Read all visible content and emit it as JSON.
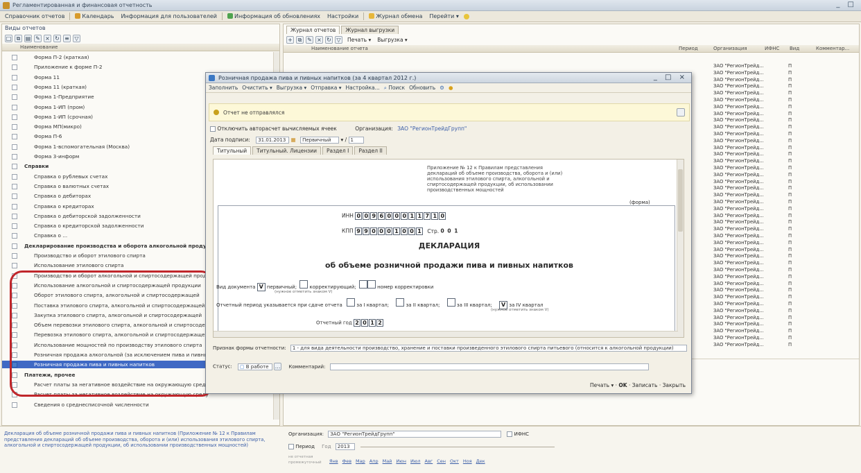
{
  "window": {
    "title": "Регламентированная и финансовая отчетность",
    "controls": "_ □"
  },
  "menubar": [
    "Справочник отчетов",
    "Календарь",
    "Информация для пользователей",
    "Информация об обновлениях",
    "Настройки",
    "Журнал обмена",
    "Перейти ▾"
  ],
  "left_panel": {
    "header": "Виды отчетов",
    "column": "Наименование",
    "rows": [
      {
        "label": "Форма П-2 (краткая)",
        "indent": 1,
        "checked": false,
        "group": false
      },
      {
        "label": "Приложение к форме П-2",
        "indent": 1,
        "checked": false,
        "group": false
      },
      {
        "label": "Форма 11",
        "indent": 1,
        "checked": false,
        "group": false
      },
      {
        "label": "Форма 11 (краткая)",
        "indent": 1,
        "checked": false,
        "group": false
      },
      {
        "label": "Форма 1-Предприятие",
        "indent": 1,
        "checked": false,
        "group": false
      },
      {
        "label": "Форма 1-ИП (пром)",
        "indent": 1,
        "checked": false,
        "group": false
      },
      {
        "label": "Форма 1-ИП (срочная)",
        "indent": 1,
        "checked": false,
        "group": false
      },
      {
        "label": "Форма МП(микро)",
        "indent": 1,
        "checked": false,
        "group": false
      },
      {
        "label": "Форма П-6",
        "indent": 1,
        "checked": false,
        "group": false
      },
      {
        "label": "Форма 1-вспомогательная (Москва)",
        "indent": 1,
        "checked": false,
        "group": false
      },
      {
        "label": "Форма 3-информ",
        "indent": 1,
        "checked": false,
        "group": false
      },
      {
        "label": "Справки",
        "indent": 0,
        "checked": false,
        "group": true
      },
      {
        "label": "Справка о рублевых счетах",
        "indent": 1,
        "checked": false,
        "group": false
      },
      {
        "label": "Справка о валютных счетах",
        "indent": 1,
        "checked": false,
        "group": false
      },
      {
        "label": "Справка о дебиторах",
        "indent": 1,
        "checked": false,
        "group": false
      },
      {
        "label": "Справка о кредиторах",
        "indent": 1,
        "checked": false,
        "group": false
      },
      {
        "label": "Справка о дебиторской задолженности",
        "indent": 1,
        "checked": false,
        "group": false
      },
      {
        "label": "Справка о кредиторской задолженности",
        "indent": 1,
        "checked": false,
        "group": false
      },
      {
        "label": "Справка о ...",
        "indent": 1,
        "checked": false,
        "group": false
      },
      {
        "label": "Декларирование производства и оборота алкогольной продукции",
        "indent": 0,
        "checked": false,
        "group": true
      },
      {
        "label": "Производство и оборот этилового спирта",
        "indent": 1,
        "checked": false,
        "group": false
      },
      {
        "label": "Использование этилового спирта",
        "indent": 1,
        "checked": false,
        "group": false
      },
      {
        "label": "Производство и оборот алкогольной и спиртосодержащей продукции",
        "indent": 1,
        "checked": false,
        "group": false
      },
      {
        "label": "Использование алкогольной и спиртосодержащей продукции",
        "indent": 1,
        "checked": false,
        "group": false
      },
      {
        "label": "Оборот этилового спирта, алкогольной и спиртосодержащей",
        "indent": 1,
        "checked": false,
        "group": false
      },
      {
        "label": "Поставка этилового спирта, алкогольной и спиртосодержащей",
        "indent": 1,
        "checked": false,
        "group": false
      },
      {
        "label": "Закупка этилового спирта, алкогольной и спиртосодержащей",
        "indent": 1,
        "checked": false,
        "group": false
      },
      {
        "label": "Объем перевозки этилового спирта, алкогольной и спиртосодержащей",
        "indent": 1,
        "checked": false,
        "group": false
      },
      {
        "label": "Перевозка этилового спирта, алкогольной и спиртосодержащей",
        "indent": 1,
        "checked": false,
        "group": false
      },
      {
        "label": "Использование мощностей по производству этилового спирта",
        "indent": 1,
        "checked": false,
        "group": false
      },
      {
        "label": "Розничная продажа алкогольной (за исключением пива и пивных напитков)",
        "indent": 1,
        "checked": false,
        "group": false
      },
      {
        "label": "Розничная продажа пива и пивных напитков",
        "indent": 1,
        "checked": true,
        "group": false,
        "selected": true
      },
      {
        "label": "Платежи, прочее",
        "indent": 0,
        "checked": false,
        "group": true
      },
      {
        "label": "Расчет платы за негативное воздействие на окружающую среду (основная форма)",
        "indent": 1,
        "checked": false,
        "group": false
      },
      {
        "label": "Расчет платы за негативное воздействие на окружающую среду",
        "indent": 1,
        "checked": false,
        "group": false
      },
      {
        "label": "Сведения о среднесписочной численности",
        "indent": 1,
        "checked": false,
        "group": false
      }
    ],
    "description": "Декларация об объеме розничной продажи пива и пивных напитков (Приложение № 12 к Правилам представления деклараций об объеме производства, оборота и (или) использования этилового спирта, алкогольной и спиртосодержащей продукции, об использовании производственных мощностей)"
  },
  "journal": {
    "tabs": [
      "Журнал отчетов",
      "Журнал выгрузки"
    ],
    "toolbar": [
      "Печать ▾",
      "Выгрузка ▾"
    ],
    "columns": [
      "Наименование отчета",
      "Период",
      "Организация",
      "ИФНС",
      "Вид",
      "Комментар..."
    ],
    "org_rows": [
      "ЗАО \"РегионТрейд...",
      "ЗАО \"РегионТрейд...",
      "ЗАО \"РегионТрейд...",
      "ЗАО \"РегионТрейд...",
      "ЗАО \"РегионТрейд...",
      "ЗАО \"РегионТрейд...",
      "ЗАО \"РегионТрейд...",
      "ЗАО \"РегионТрейд...",
      "ЗАО \"РегионТрейд...",
      "ЗАО \"РегионТрейд...",
      "ЗАО \"РегионТрейд...",
      "ЗАО \"РегионТрейд...",
      "ЗАО \"РегионТрейд...",
      "ЗАО \"РегионТрейд...",
      "ЗАО \"РегионТрейд...",
      "ЗАО \"РегионТрейд...",
      "ЗАО \"РегионТрейд...",
      "ЗАО \"РегионТрейд...",
      "ЗАО \"РегионТрейд...",
      "ЗАО \"РегионТрейд...",
      "ЗАО \"РегионТрейд...",
      "ЗАО \"РегионТрейд...",
      "ЗАО \"РегионТрейд...",
      "ЗАО \"РегионТрейд...",
      "ЗАО \"РегионТрейд...",
      "ЗАО \"РегионТрейд...",
      "ЗАО \"РегионТрейд...",
      "ЗАО \"РегионТрейд...",
      "ЗАО \"РегионТрейд...",
      "ЗАО \"РегионТрейд...",
      "ЗАО \"РегионТрейд...",
      "ЗАО \"РегионТрейд...",
      "ЗАО \"РегионТрейд...",
      "ЗАО \"РегионТрейд...",
      "ЗАО \"РегионТрейд...",
      "ЗАО \"РегионТрейд...",
      "ЗАО \"РегионТрейд...",
      "ЗАО \"РегионТрейд...",
      "ЗАО \"РегионТрейд...",
      "ЗАО \"РегионТрейд...",
      "ЗАО \"РегионТрейд...",
      "ЗАО \"РегионТрейд..."
    ],
    "kind_value": "П"
  },
  "filter": {
    "org_label": "Организация:",
    "org_value": "ЗАО \"РегионТрейдГрупп\"",
    "ifns_label": "ИФНС",
    "period_label": "Период",
    "year_label": "Год",
    "year_value": "2013",
    "months": [
      "Янв",
      "Фев",
      "Мар",
      "Апр",
      "Май",
      "Июн",
      "Июл",
      "Авг",
      "Сен",
      "Окт",
      "Ноя",
      "Дек"
    ],
    "opt1": "не отчетная",
    "opt2": "промежуточный"
  },
  "dialog": {
    "title": "Розничная продажа пива и пивных напитков (за 4 квартал 2012 г.)",
    "controls": "_ □ ×",
    "menu": [
      "Заполнить",
      "Очистить ▾",
      "Выгрузка ▾",
      "Отправка ▾",
      "Настройка...",
      "Поиск",
      "Обновить"
    ],
    "notice": "Отчет не отправлялся",
    "autocalc_label": "Отключить авторасчет вычисляемых ячеек",
    "org_label": "Организация:",
    "org_value": "ЗАО \"РегионТрейдГрупп\"",
    "date_label": "Дата подписи:",
    "date_value": "31.01.2013",
    "type_value": "Первичный",
    "num_value": "1",
    "tabs": [
      "Титульный",
      "Титульный. Лицензии",
      "Раздел I",
      "Раздел II"
    ],
    "form": {
      "appendix": "Приложение № 12 к Правилам представления деклараций об объеме производства, оборота и (или) использования этилового спирта, алкогольной и спиртосодержащей продукции, об использовании производственных мощностей",
      "form_label": "(форма)",
      "inn_label": "ИНН",
      "inn_digits": [
        "0",
        "0",
        "9",
        "6",
        "0",
        "0",
        "0",
        "1",
        "1",
        "7",
        "1",
        "0"
      ],
      "kpp_label": "КПП",
      "kpp_digits": [
        "9",
        "9",
        "0",
        "0",
        "0",
        "1",
        "0",
        "0",
        "1"
      ],
      "page_label": "Стр.",
      "page_value": "0 0 1",
      "heading": "ДЕКЛАРАЦИЯ",
      "subheading": "об объеме розничной продажи пива и пивных напитков",
      "doc_kind_label": "Вид документа",
      "mark_v": "V",
      "primary": "первичный;",
      "corrective": "корректирующий;",
      "corr_number": "номер корректировки",
      "hint": "(нужное отметить знаком V)",
      "period_label": "Отчетный период указывается при сдаче отчета",
      "q1": "за I квартал;",
      "q2": "за II квартал;",
      "q3": "за III квартал;",
      "q4": "за IV квартал",
      "year_label": "Отчетный год",
      "year_digits": [
        "2",
        "0",
        "1",
        "2"
      ]
    },
    "sign_label": "Признак формы отчетности:",
    "sign_value": "1 - для вида деятельности производство, хранение и поставки произведенного этилового спирта питьевого (относится к алкогольной продукции)",
    "status_label": "Статус:",
    "status_value": "В работе",
    "comment_label": "Комментарий:",
    "buttons": {
      "print": "Печать ▾",
      "ok": "OK",
      "save": "Записать",
      "close": "Закрыть"
    }
  },
  "colors": {
    "selection": "#3f69c4",
    "highlight": "#c0262b",
    "notice_bg": "#fdf8d8"
  }
}
